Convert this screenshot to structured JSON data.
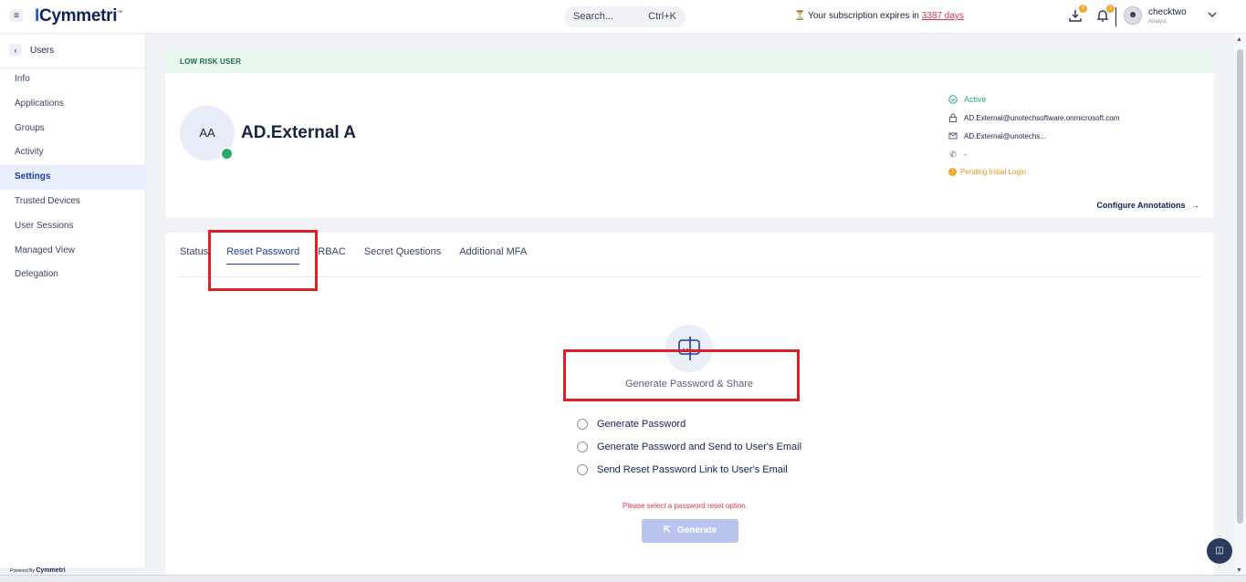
{
  "topbar": {
    "logo": "Cymmetri",
    "logo_tm": "™",
    "search_placeholder": "Search...",
    "search_shortcut": "Ctrl+K",
    "subscription_prefix": "Your subscription expires in",
    "subscription_days": "3387 days",
    "download_badge": "9",
    "notification_badge": "9",
    "user_name": "checktwo",
    "user_role": "Analyst"
  },
  "sidebar": {
    "back_label": "Users",
    "items": [
      {
        "label": "Info"
      },
      {
        "label": "Applications"
      },
      {
        "label": "Groups"
      },
      {
        "label": "Activity"
      },
      {
        "label": "Settings",
        "active": true
      },
      {
        "label": "Trusted Devices"
      },
      {
        "label": "User Sessions"
      },
      {
        "label": "Managed View"
      },
      {
        "label": "Delegation"
      }
    ],
    "powered_by_prefix": "Powered By",
    "powered_by_brand": "Cymmetri"
  },
  "profile": {
    "risk_label": "LOW RISK USER",
    "initials": "AA",
    "display_name": "AD.External A",
    "status": "Active",
    "login": "AD.External@unotechsoftware.onmicrosoft.com",
    "email": "AD.External@unotechs...",
    "phone": "-",
    "pending": "Pending Initial Login",
    "configure_label": "Configure Annotations",
    "configure_arrow": "→"
  },
  "tabs": [
    {
      "label": "Status"
    },
    {
      "label": "Reset Password",
      "active": true
    },
    {
      "label": "RBAC"
    },
    {
      "label": "Secret Questions"
    },
    {
      "label": "Additional MFA"
    }
  ],
  "reset": {
    "heading": "Generate Password & Share",
    "options": [
      "Generate Password",
      "Generate Password and Send to User's Email",
      "Send Reset Password Link to User's Email"
    ],
    "error": "Please select a password reset option.",
    "button_label": "Generate"
  },
  "colors": {
    "accent": "#1b3fae",
    "highlight": "#de1f26",
    "active_green": "#2fa870",
    "pending_orange": "#e8951b",
    "error_red": "#d8394b"
  }
}
